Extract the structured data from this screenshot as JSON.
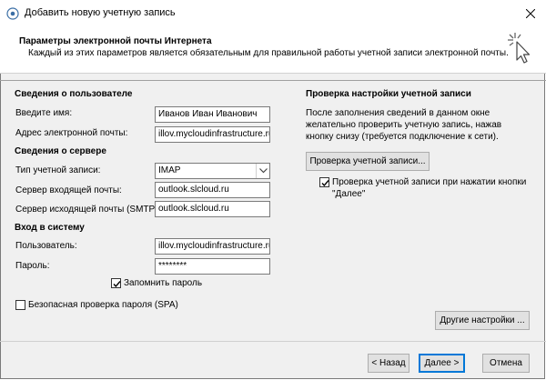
{
  "window": {
    "title": "Добавить новую учетную запись"
  },
  "header": {
    "title": "Параметры электронной почты Интернета",
    "subtitle": "Каждый из этих параметров является обязательным для правильной работы учетной записи электронной почты."
  },
  "user_info": {
    "section_title": "Сведения о пользователе",
    "name_label": "Введите имя:",
    "name_value": "Иванов Иван Иванович",
    "email_label": "Адрес электронной почты:",
    "email_value": "illov.mycloudinfrastructure.ru"
  },
  "server_info": {
    "section_title": "Сведения о сервере",
    "account_type_label": "Тип учетной записи:",
    "account_type_value": "IMAP",
    "incoming_label": "Сервер входящей почты:",
    "incoming_value": "outlook.slcloud.ru",
    "outgoing_label": "Сервер исходящей почты (SMTP):",
    "outgoing_value": "outlook.slcloud.ru"
  },
  "login": {
    "section_title": "Вход в систему",
    "user_label": "Пользователь:",
    "user_value": "illov.mycloudinfrastructure.ru(",
    "password_label": "Пароль:",
    "password_value": "********",
    "remember_label": "Запомнить пароль",
    "remember_checked": true,
    "spa_label": "Безопасная проверка пароля (SPA)",
    "spa_checked": false
  },
  "test": {
    "section_title": "Проверка настройки учетной записи",
    "description": "После заполнения сведений в данном окне желательно проверить учетную запись, нажав кнопку снизу (требуется подключение к сети).",
    "test_button": "Проверка учетной записи...",
    "auto_test_label_line1": "Проверка учетной записи при нажатии кнопки",
    "auto_test_label_line2": "\"Далее\"",
    "auto_test_checked": true
  },
  "buttons": {
    "more_settings": "Другие настройки ...",
    "back": "< Назад",
    "next": "Далее >",
    "cancel": "Отмена"
  },
  "colors": {
    "accent": "#0078d7",
    "window_bg": "#f0f0f0"
  }
}
